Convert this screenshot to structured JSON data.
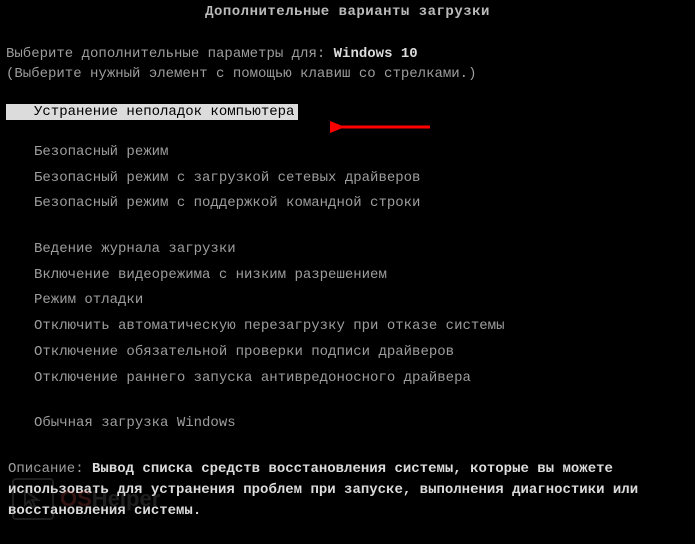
{
  "header": {
    "title": "Дополнительные варианты загрузки"
  },
  "prompt": {
    "text": "Выберите дополнительные параметры для: ",
    "os_name": "Windows 10"
  },
  "hint": "(Выберите нужный элемент с помощью клавиш со стрелками.)",
  "menu": {
    "selected": "Устранение неполадок компьютера",
    "group1": [
      "Безопасный режим",
      "Безопасный режим с загрузкой сетевых драйверов",
      "Безопасный режим с поддержкой командной строки"
    ],
    "group2": [
      "Ведение журнала загрузки",
      "Включение видеорежима с низким разрешением",
      "Режим отладки",
      "Отключить автоматическую перезагрузку при отказе системы",
      "Отключение обязательной проверки подписи драйверов",
      "Отключение раннего запуска антивредоносного драйвера"
    ],
    "group3": [
      "Обычная загрузка Windows"
    ]
  },
  "description": {
    "label": "Описание: ",
    "text": "Вывод списка средств восстановления системы, которые вы можете использовать для устранения проблем при запуске, выполнения диагностики или восстановления системы."
  },
  "annotation": {
    "arrow_color": "#ff0000"
  },
  "watermark": {
    "part1": "OS",
    "part2": "Helper"
  }
}
